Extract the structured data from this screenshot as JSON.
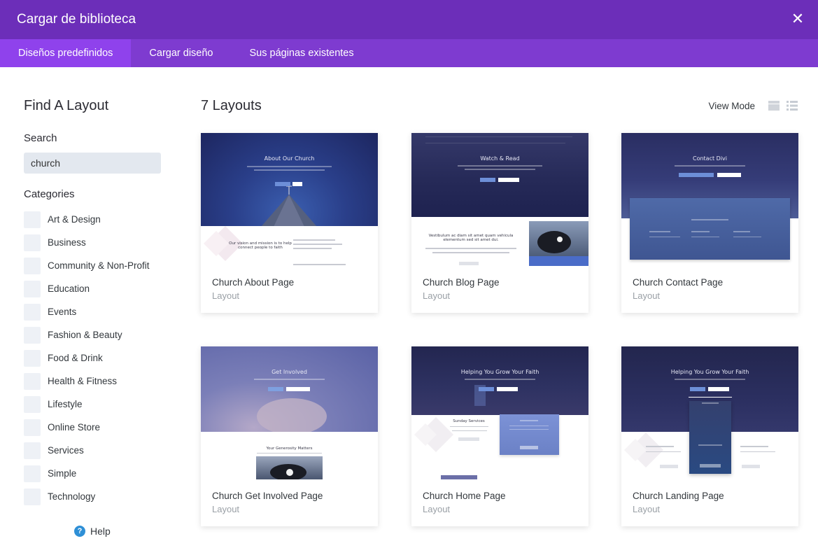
{
  "header": {
    "title": "Cargar de biblioteca",
    "close_icon": "close-icon"
  },
  "tabs": [
    {
      "label": "Diseños predefinidos",
      "active": true
    },
    {
      "label": "Cargar diseño",
      "active": false
    },
    {
      "label": "Sus páginas existentes",
      "active": false
    }
  ],
  "sidebar": {
    "title": "Find A Layout",
    "search_label": "Search",
    "search_value": "church",
    "categories_label": "Categories",
    "categories": [
      "Art & Design",
      "Business",
      "Community & Non-Profit",
      "Education",
      "Events",
      "Fashion & Beauty",
      "Food & Drink",
      "Health & Fitness",
      "Lifestyle",
      "Online Store",
      "Services",
      "Simple",
      "Technology"
    ],
    "help_label": "Help"
  },
  "main": {
    "title": "7 Layouts",
    "view_mode_label": "View Mode",
    "layouts": [
      {
        "name": "Church About Page",
        "type": "Layout",
        "thumb_title": "About Our Church"
      },
      {
        "name": "Church Blog Page",
        "type": "Layout",
        "thumb_title": "Watch & Read"
      },
      {
        "name": "Church Contact Page",
        "type": "Layout",
        "thumb_title": "Contact Divi"
      },
      {
        "name": "Church Get Involved Page",
        "type": "Layout",
        "thumb_title": "Get Involved"
      },
      {
        "name": "Church Home Page",
        "type": "Layout",
        "thumb_title": "Helping You Grow Your Faith"
      },
      {
        "name": "Church Landing Page",
        "type": "Layout",
        "thumb_title": "Helping You Grow Your Faith"
      }
    ]
  },
  "colors": {
    "header": "#6c2eb9",
    "tabbar": "#7e3bd0",
    "active_tab": "#8f42ec",
    "help": "#2e8fd6"
  }
}
